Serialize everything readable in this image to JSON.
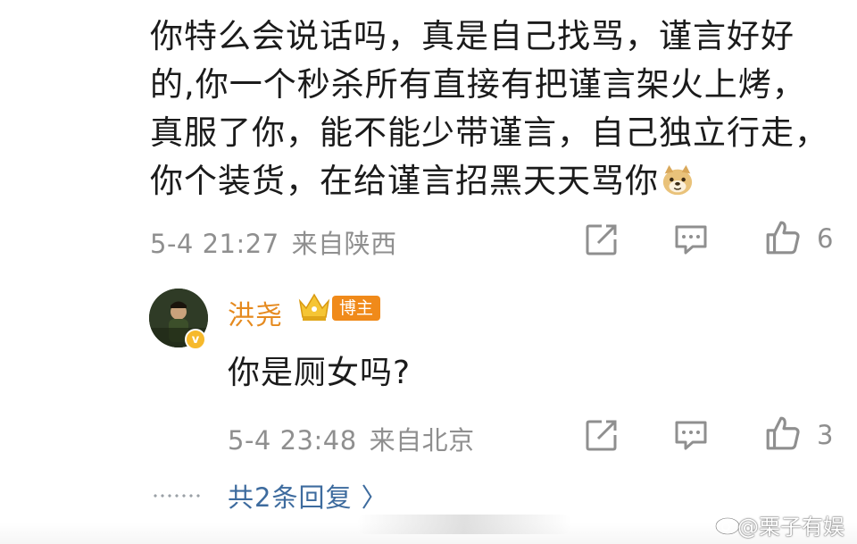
{
  "comment": {
    "lines": [
      "你特么会说话吗，真是自己找骂，谨言好好",
      "的,你一个秒杀所有直接有把谨言架火上烤，",
      "真服了你，能不能少带谨言，自己独立行走，",
      "你个装货，在给谨言招黑天天骂你"
    ],
    "time": "5-4 21:27",
    "location": "来自陕西",
    "like_count": "6"
  },
  "reply": {
    "username": "洪尧",
    "badge": "博主",
    "text": "你是厕女吗?",
    "time": "5-4 23:48",
    "location": "来自北京",
    "like_count": "3",
    "verified_mark": "v"
  },
  "more_replies": "共2条回复 〉",
  "watermark": "@栗子有娱",
  "icons": [
    "share-icon",
    "comment-icon",
    "like-icon",
    "doge-emoji",
    "crown-icon"
  ],
  "colors": {
    "username": "#e58a1f",
    "badge": "#f08a1a",
    "link": "#3d6b9e",
    "meta": "#8f8f8f"
  }
}
